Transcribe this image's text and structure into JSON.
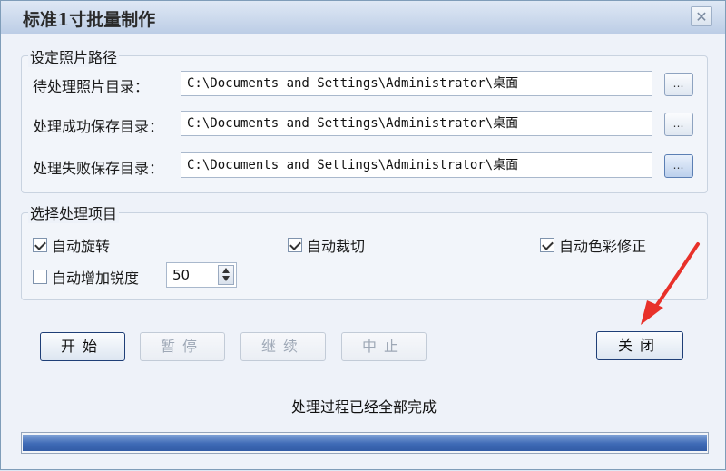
{
  "window": {
    "title": "标准1寸批量制作",
    "close_glyph": "✕"
  },
  "path_group": {
    "title": "设定照片路径",
    "rows": [
      {
        "label": "待处理照片目录：",
        "value": "C:\\Documents and Settings\\Administrator\\桌面",
        "browse": "…"
      },
      {
        "label": "处理成功保存目录：",
        "value": "C:\\Documents and Settings\\Administrator\\桌面",
        "browse": "…"
      },
      {
        "label": "处理失败保存目录：",
        "value": "C:\\Documents and Settings\\Administrator\\桌面",
        "browse": "…"
      }
    ]
  },
  "options_group": {
    "title": "选择处理项目",
    "auto_rotate": {
      "label": "自动旋转",
      "checked": true
    },
    "auto_crop": {
      "label": "自动裁切",
      "checked": true
    },
    "auto_color": {
      "label": "自动色彩修正",
      "checked": true
    },
    "auto_sharpen": {
      "label": "自动增加锐度",
      "checked": false,
      "value": "50"
    }
  },
  "buttons": {
    "start": "开始",
    "pause": "暂停",
    "resume": "继续",
    "stop": "中止",
    "close": "关闭"
  },
  "status_text": "处理过程已经全部完成",
  "progress": {
    "fraction": 1.0
  },
  "colors": {
    "accent": "#3f6bb6",
    "annotation_arrow": "#e8312a"
  }
}
